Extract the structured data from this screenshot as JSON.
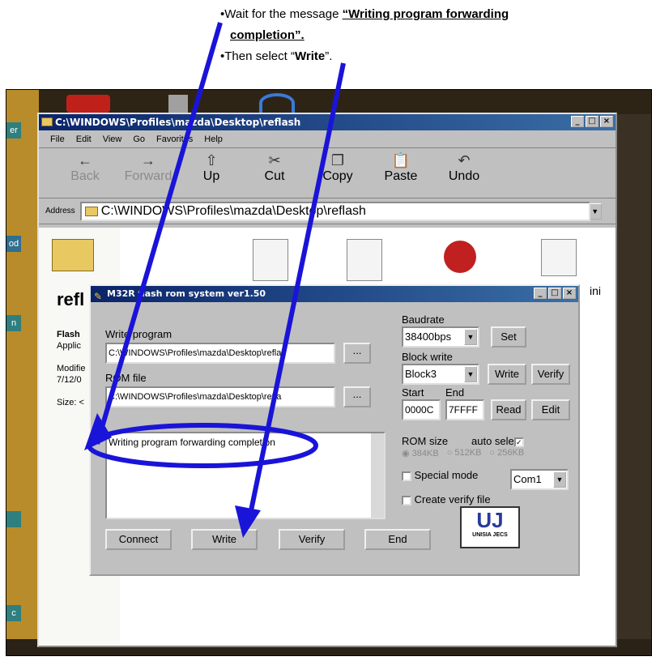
{
  "instructions": {
    "line1_prefix": "Wait for the message",
    "line1_message": "“Writing program forwarding",
    "line2_message": "completion”.",
    "line3_prefix": "Then select “",
    "line3_bold": "Write",
    "line3_suffix": "”."
  },
  "explorer": {
    "title": "C:\\WINDOWS\\Profiles\\mazda\\Desktop\\reflash",
    "menu": [
      "File",
      "Edit",
      "View",
      "Go",
      "Favorites",
      "Help"
    ],
    "toolbar": [
      {
        "label": "Back",
        "icon": "back-arrow-icon",
        "glyph": "←"
      },
      {
        "label": "Forward",
        "icon": "forward-arrow-icon",
        "glyph": "→"
      },
      {
        "label": "Up",
        "icon": "up-folder-icon",
        "glyph": "⇧"
      },
      {
        "label": "Cut",
        "icon": "scissors-icon",
        "glyph": "✂"
      },
      {
        "label": "Copy",
        "icon": "copy-icon",
        "glyph": "❐"
      },
      {
        "label": "Paste",
        "icon": "paste-icon",
        "glyph": "📋"
      },
      {
        "label": "Undo",
        "icon": "undo-icon",
        "glyph": "↶"
      }
    ],
    "address_label": "Address",
    "address_value": "C:\\WINDOWS\\Profiles\\mazda\\Desktop\\reflash",
    "side_title": "refl",
    "side_item1": "Flash",
    "side_item2": "Applic",
    "side_item3": "Modifie",
    "side_item4": "7/12/0",
    "side_item5": "Size: <",
    "right_label": "ini"
  },
  "dialog": {
    "title": "M32R flash rom system ver1.50",
    "write_program_label": "Write program",
    "write_program_value": "C:\\WINDOWS\\Profiles\\mazda\\Desktop\\refla",
    "rom_file_label": "ROM file",
    "rom_file_value": "C:\\WINDOWS\\Profiles\\mazda\\Desktop\\refla",
    "browse_label": "...",
    "log_message": "Writing program forwarding completion",
    "baudrate_label": "Baudrate",
    "baudrate_value": "38400bps",
    "set_label": "Set",
    "block_write_label": "Block write",
    "block_value": "Block3",
    "block_write_button": "Write",
    "block_verify_button": "Verify",
    "start_label": "Start",
    "end_label": "End",
    "start_value": "0000C",
    "end_value": "7FFFF",
    "read_label": "Read",
    "edit_label": "Edit",
    "rom_size_label": "ROM size",
    "auto_select_label": "auto sele",
    "rom_sizes": [
      "384KB",
      "512KB",
      "256KB"
    ],
    "special_mode_label": "Special mode",
    "com_value": "Com1",
    "create_verify_label": "Create verify file",
    "connect_label": "Connect",
    "write_label": "Write",
    "verify_label": "Verify",
    "end_button_label": "End",
    "logo_text": "UNISIA JECS"
  },
  "colors": {
    "annotation_blue": "#1a14d8",
    "titlebar_blue": "#0a246a",
    "window_gray": "#c0c0c0"
  }
}
